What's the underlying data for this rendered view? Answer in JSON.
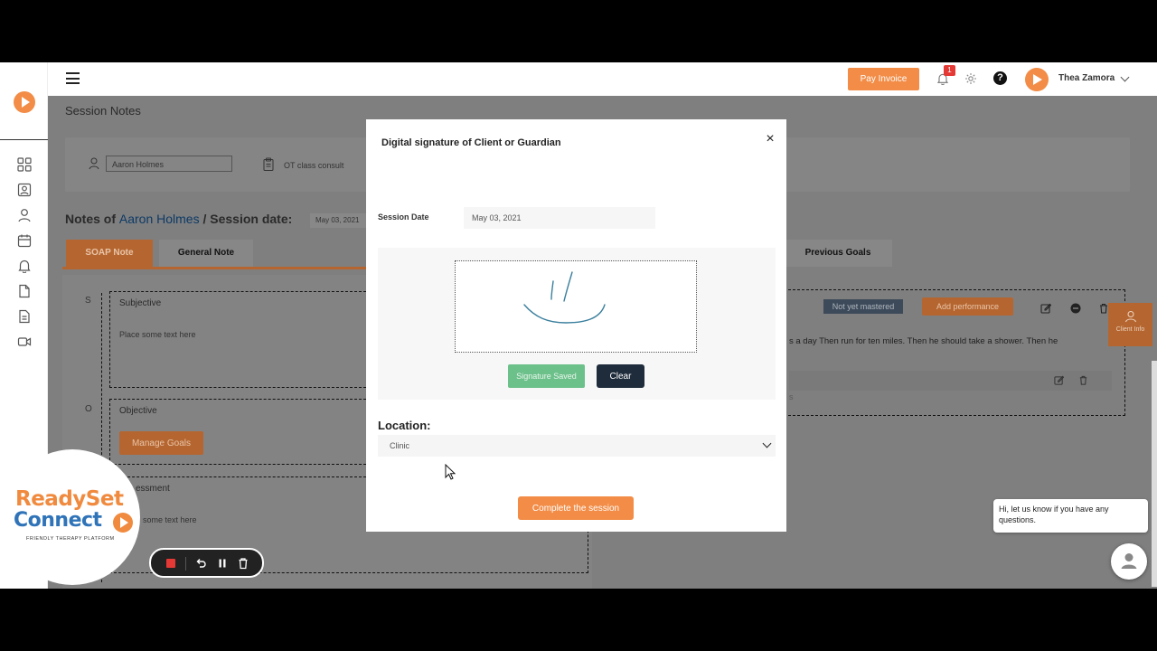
{
  "header": {
    "pay_invoice_label": "Pay Invoice",
    "notification_count": "1",
    "help_glyph": "?",
    "user_name": "Thea Zamora"
  },
  "page": {
    "title": "Session Notes",
    "client_select_value": "Aaron Holmes",
    "class_label": "OT class consult",
    "notes_prefix": "Notes of",
    "notes_client": "Aaron Holmes",
    "session_date_label": "/ Session date:",
    "session_date_value": "May 03, 2021",
    "tabs": [
      {
        "label": "SOAP Note"
      },
      {
        "label": "General Note"
      },
      {
        "label": "Previous Goals"
      }
    ],
    "soap": {
      "s_letter": "S",
      "o_letter": "O",
      "subjective_label": "Subjective",
      "subjective_placeholder": "Place some text here",
      "objective_label": "Objective",
      "manage_goals_label": "Manage Goals",
      "assessment_label": "essment",
      "assessment_placeholder": "some text here"
    },
    "goals": {
      "status_badge": "Not yet mastered",
      "add_performance_label": "Add performance",
      "goal_text": "s a day Then run for ten miles. Then he should take a shower. Then he",
      "goal_row_suffix": "s"
    },
    "client_info_label": "Client Info"
  },
  "logo": {
    "word1": "ReadySet",
    "word2": "Connect",
    "tagline": "FRIENDLY THERAPY PLATFORM"
  },
  "chat": {
    "message": "Hi, let us know if you have any questions."
  },
  "modal": {
    "title": "Digital signature of Client or Guardian",
    "close_glyph": "×",
    "session_date_label": "Session Date",
    "session_date_value": "May 03, 2021",
    "signature_saved_label": "Signature Saved",
    "clear_label": "Clear",
    "location_label": "Location:",
    "location_value": "Clinic",
    "complete_label": "Complete the session"
  },
  "colors": {
    "brand_orange": "#f28c46",
    "brand_blue": "#2f73b8",
    "success_green": "#6cc08a",
    "dark_navy": "#1f2c3c"
  }
}
